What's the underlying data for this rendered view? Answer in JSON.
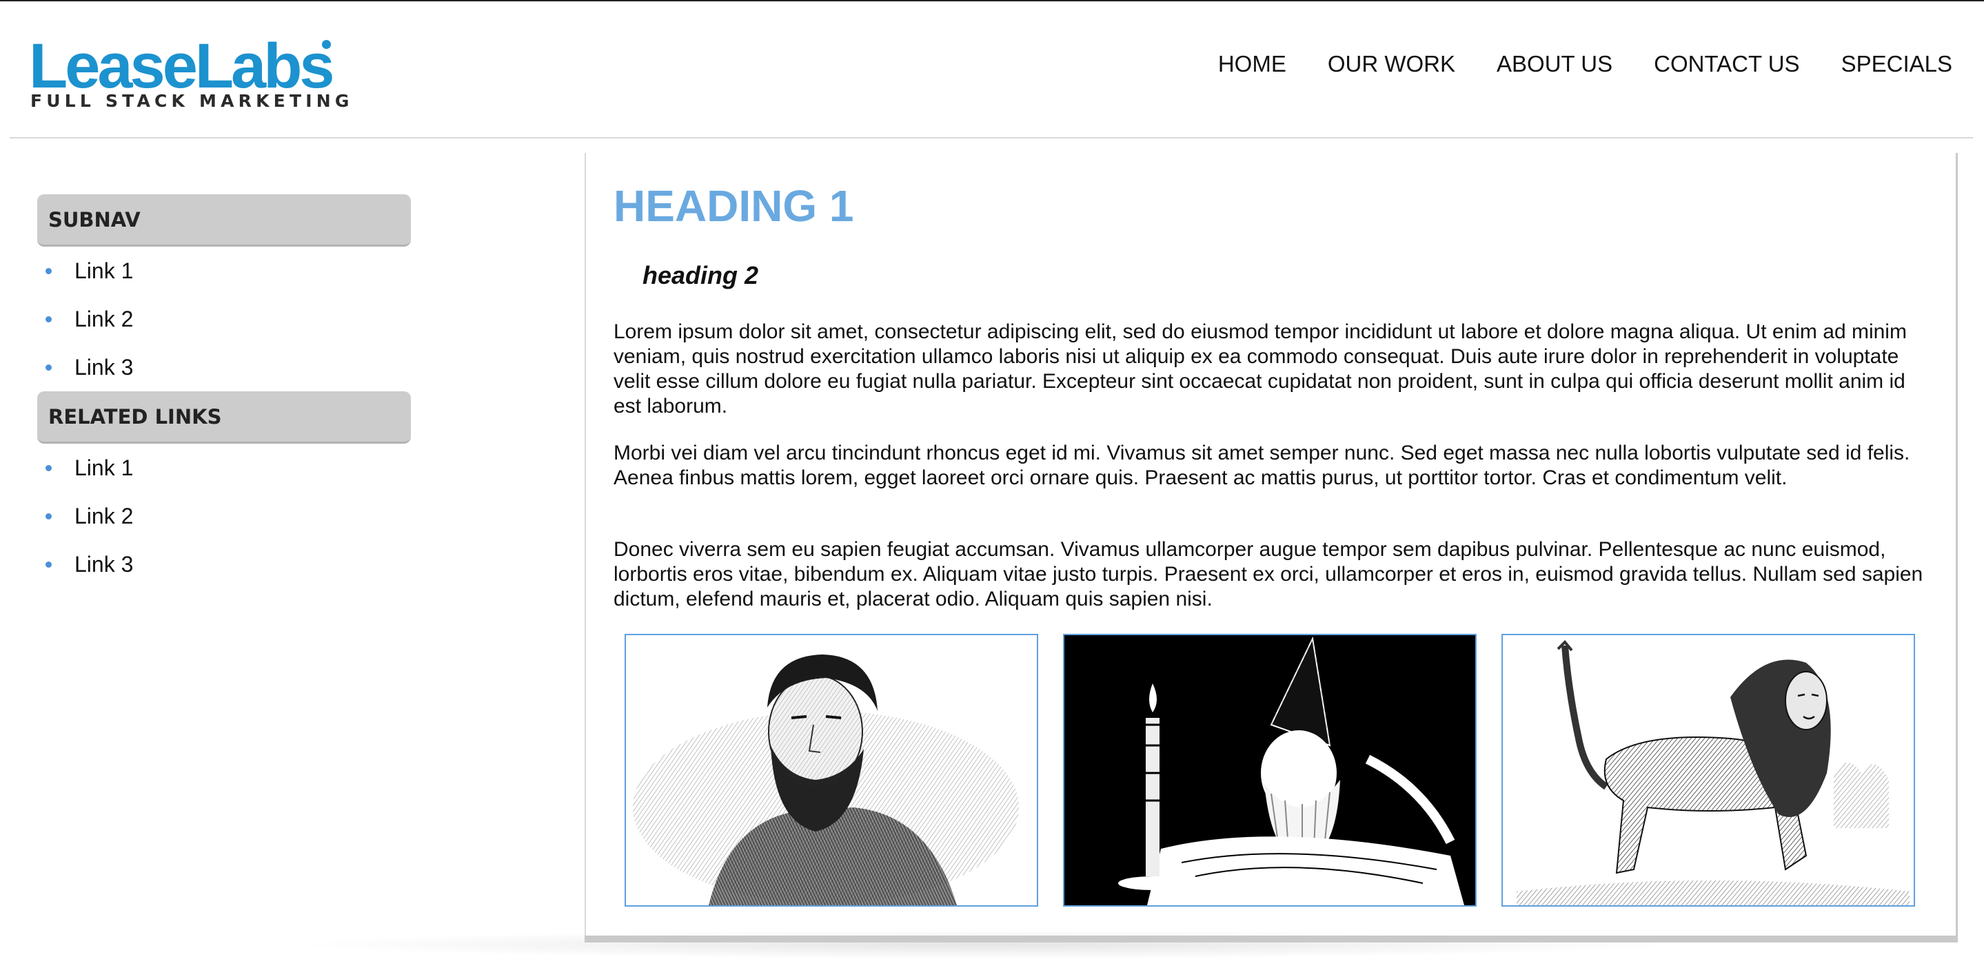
{
  "header": {
    "logo": {
      "name": "LeaseLabs",
      "tagline": "FULL STACK MARKETING",
      "color": "#1c92cf"
    },
    "nav": [
      "HOME",
      "OUR WORK",
      "ABOUT US",
      "CONTACT US",
      "SPECIALS"
    ]
  },
  "sidebar": {
    "subnav": {
      "title": "SUBNAV",
      "links": [
        "Link 1",
        "Link 2",
        "Link 3"
      ]
    },
    "related": {
      "title": "RELATED LINKS",
      "links": [
        "Link 1",
        "Link 2",
        "Link 3"
      ]
    },
    "bullet_color": "#4a90d9"
  },
  "main": {
    "heading1": "HEADING 1",
    "heading2": "heading 2",
    "paragraphs": [
      "Lorem ipsum dolor sit amet, consectetur adipiscing elit, sed do eiusmod tempor incididunt ut labore et dolore magna aliqua. Ut enim ad minim veniam, quis nostrud exercitation ullamco laboris nisi ut aliquip ex ea commodo consequat. Duis aute irure dolor in reprehenderit in voluptate velit esse cillum dolore eu fugiat nulla pariatur. Excepteur sint occaecat cupidatat non proident, sunt in culpa qui officia deserunt mollit anim id est laborum.",
      "Morbi vei diam vel arcu tincindunt rhoncus eget id mi. Vivamus sit amet semper nunc. Sed eget massa nec nulla lobortis vulputate sed id felis. Aenea finbus mattis lorem, egget laoreet orci ornare quis. Praesent ac mattis purus, ut porttitor tortor. Cras et condimentum velit.",
      "Donec viverra sem eu sapien feugiat accumsan. Vivamus ullamcorper augue tempor sem dapibus pulvinar. Pellentesque ac nunc euismod, lorbortis eros vitae, bibendum ex. Aliquam vitae justo turpis. Praesent ex orci, ullamcorper et eros in, euismod gravida tellus. Nullam sed sapien dictum, elefend mauris et, placerat odio. Aliquam quis sapien nisi."
    ],
    "images": [
      {
        "subject": "engraved portrait of bearded man"
      },
      {
        "subject": "wizard reading by candlelight"
      },
      {
        "subject": "engraved manticore creature"
      }
    ],
    "heading1_color": "#6aa9e0",
    "image_border_color": "#5ea0e0"
  }
}
